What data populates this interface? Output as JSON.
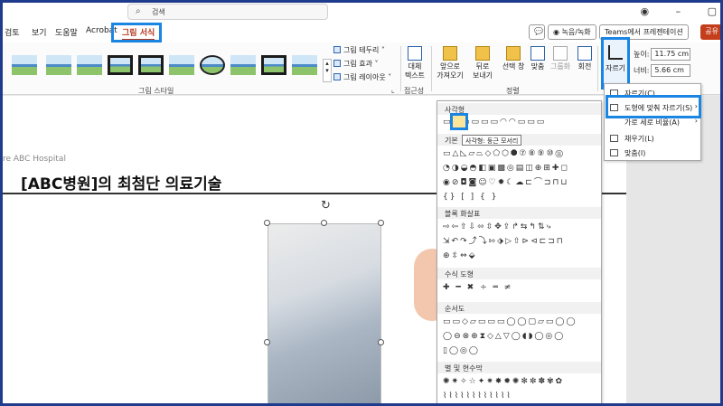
{
  "titlebar": {
    "search_placeholder": "검색"
  },
  "tabs": [
    "검토",
    "보기",
    "도움말",
    "Acrobat",
    "그림 서식"
  ],
  "header_right": {
    "record_label": "◉ 녹음/녹화",
    "teams_label": "Teams에서 프레젠테이션",
    "share_label": "공유"
  },
  "ribbon": {
    "picture_styles_label": "그림 스타일",
    "border_label": "그림 테두리",
    "effects_label": "그림 효과",
    "layout_label": "그림 레이아웃",
    "accessibility": {
      "alt_text": "대체\n텍스트",
      "group_label": "접근성"
    },
    "arrange": {
      "bring_forward": "앞으로\n가져오기",
      "send_backward": "뒤로\n보내기",
      "selection_pane": "선택 창",
      "align": "맞춤",
      "group": "그룹화",
      "rotate": "회전",
      "group_label": "정렬"
    },
    "crop_label": "자르기",
    "size": {
      "height_label": "높이:",
      "height_value": "11.75 cm",
      "width_label": "너비:",
      "width_value": "5.66 cm"
    }
  },
  "slide": {
    "hospital_text": "re ABC Hospital",
    "title": "[ABC병원]의 최첨단 의료기술"
  },
  "shape_menu": {
    "sections": {
      "rectangles": "사각형",
      "basic": "기본",
      "block_arrows": "블록 화살표",
      "equation": "수식 도형",
      "flowchart": "순서도",
      "stars": "별 및 현수막"
    },
    "tooltip": "사각형: 둥근 모서리"
  },
  "crop_menu": {
    "items": [
      "자르기(C)",
      "도형에 맞춰 자르기(S)",
      "가로 세로 비율(A)",
      "채우기(L)",
      "맞춤(I)"
    ]
  },
  "colors": {
    "accent": "#1a85e3",
    "tab_active": "#b5381f",
    "share": "#c43e1c"
  }
}
